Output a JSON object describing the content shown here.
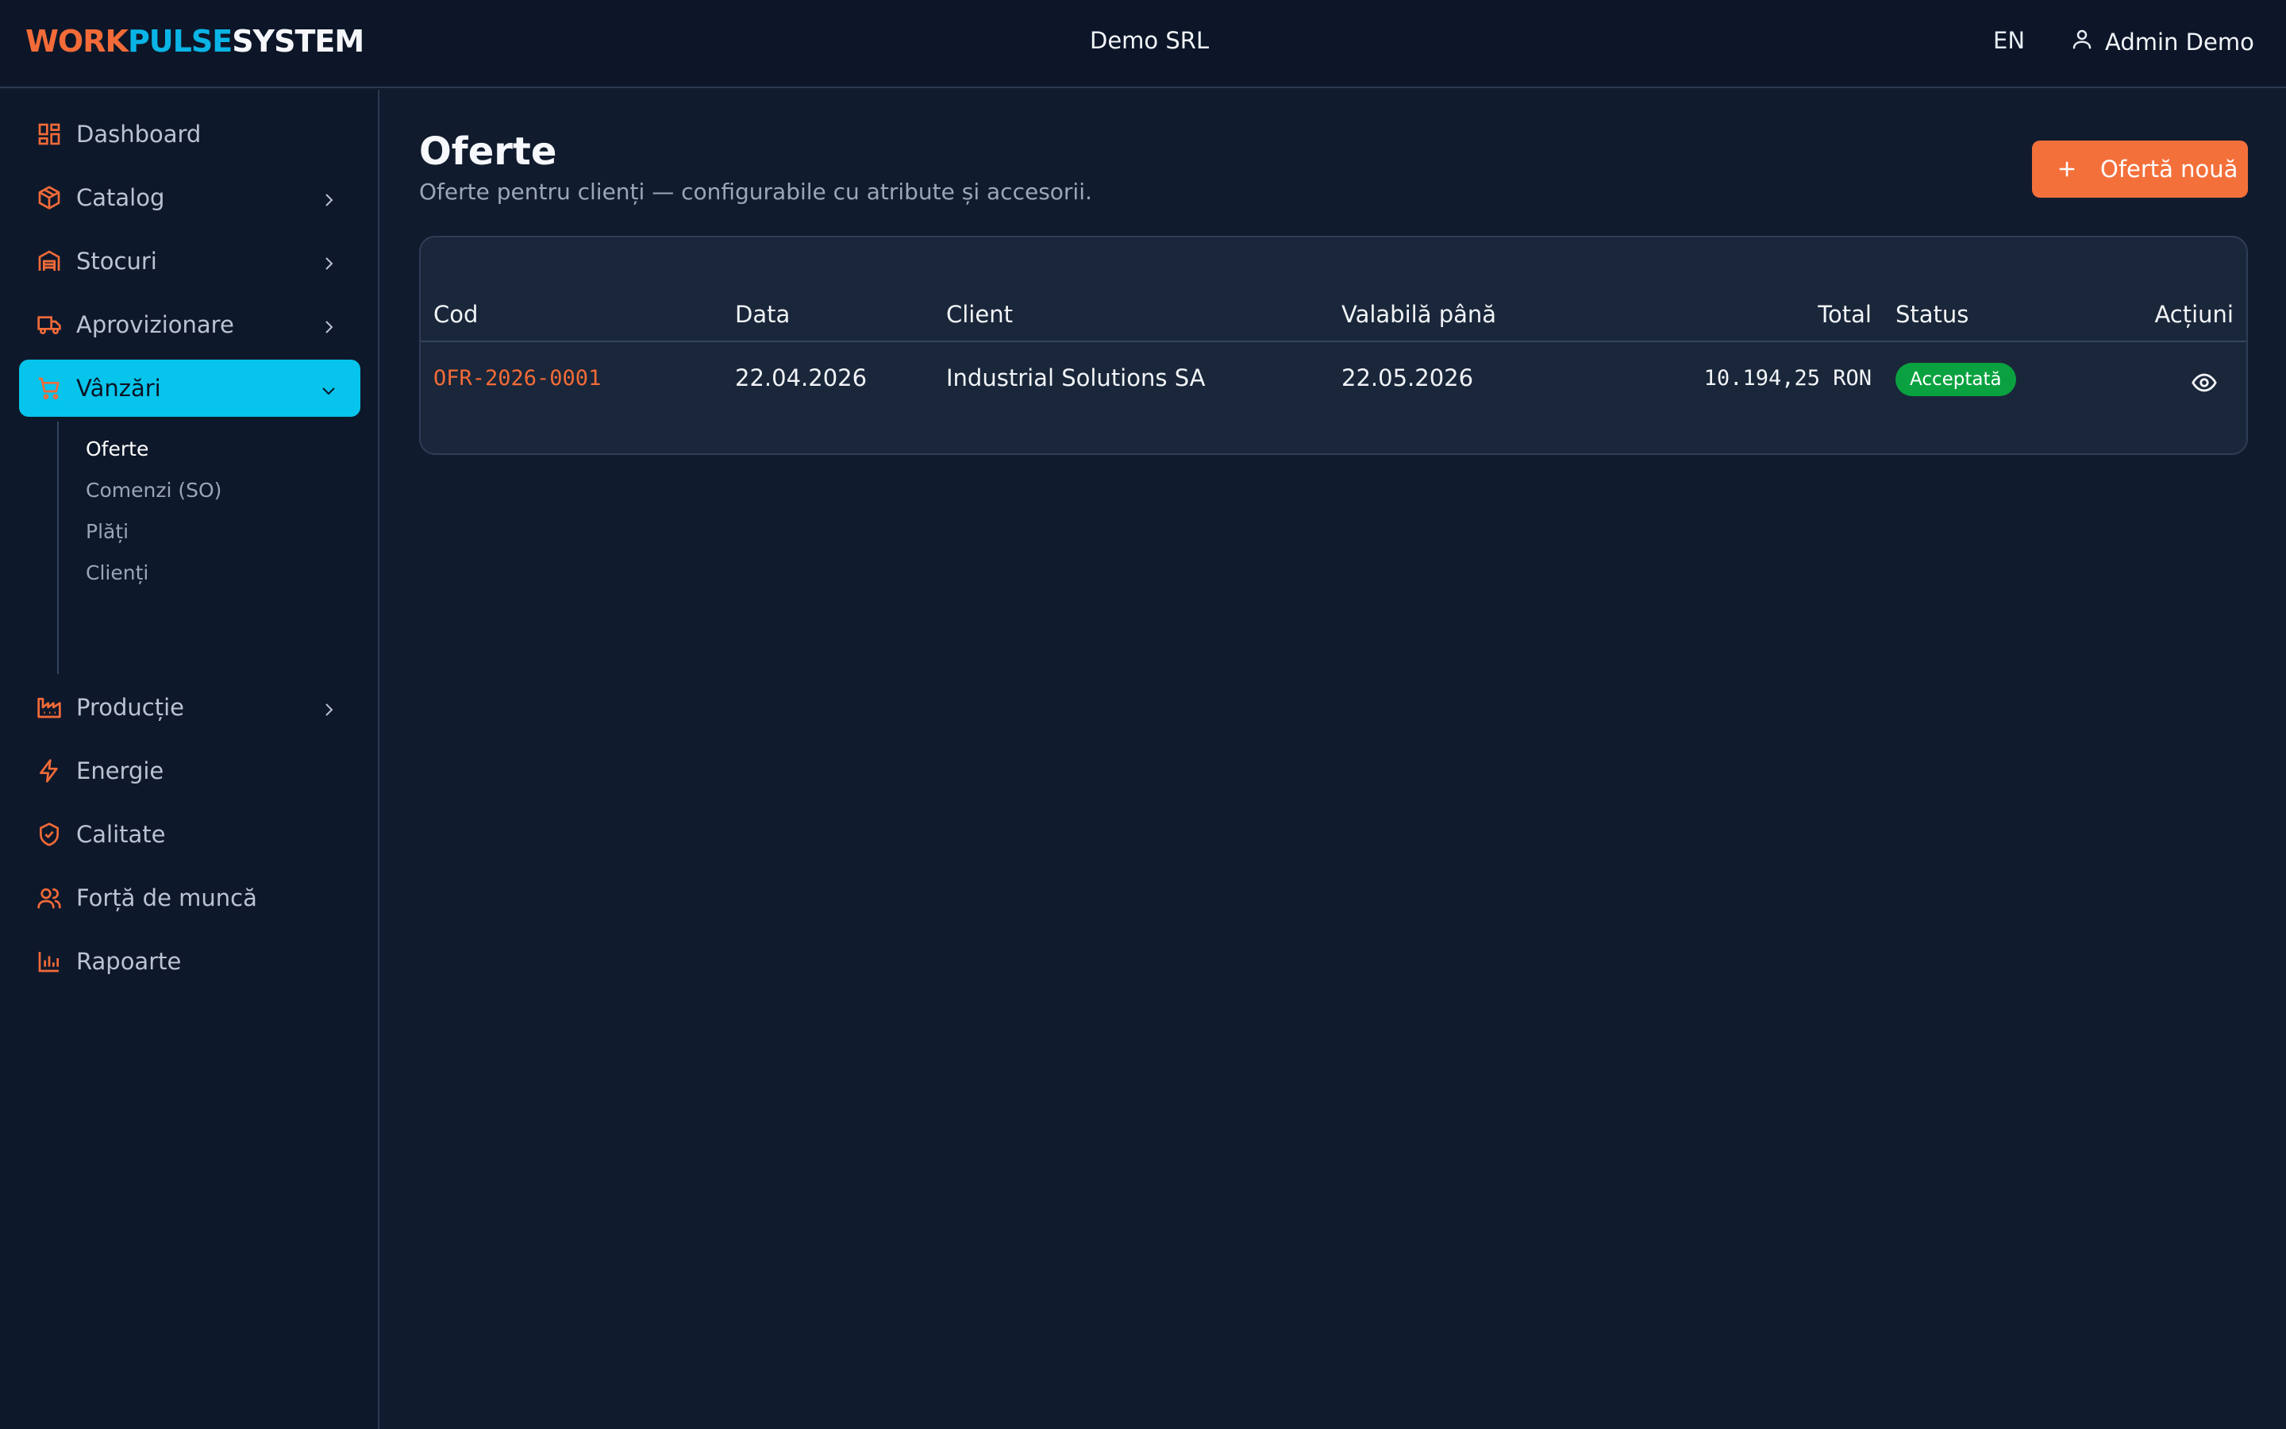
{
  "topbar": {
    "logo_a": "WORK",
    "logo_b": "PULSE",
    "logo_c": "SYSTEM",
    "company": "Demo SRL",
    "language": "EN",
    "user_name": "Admin Demo"
  },
  "sidebar": {
    "items": [
      {
        "label": "Dashboard",
        "icon": "dashboard-icon"
      },
      {
        "label": "Catalog",
        "icon": "box-icon"
      },
      {
        "label": "Stocuri",
        "icon": "warehouse-icon"
      },
      {
        "label": "Aprovizionare",
        "icon": "truck-icon"
      },
      {
        "label": "Vânzări",
        "icon": "cart-icon"
      },
      {
        "label": "Producție",
        "icon": "factory-icon"
      },
      {
        "label": "Energie",
        "icon": "lightning-icon"
      },
      {
        "label": "Calitate",
        "icon": "shield-check-icon"
      },
      {
        "label": "Forță de muncă",
        "icon": "users-icon"
      },
      {
        "label": "Rapoarte",
        "icon": "bar-chart-icon"
      }
    ],
    "sub_items": [
      {
        "label": "Oferte"
      },
      {
        "label": "Comenzi (SO)"
      },
      {
        "label": "Plăți"
      },
      {
        "label": "Clienți"
      }
    ]
  },
  "page": {
    "title": "Oferte",
    "subtitle": "Oferte pentru clienți — configurabile cu atribute și accesorii.",
    "new_button": "Ofertă nouă"
  },
  "table": {
    "headers": {
      "code": "Cod",
      "date": "Data",
      "client": "Client",
      "valid_until": "Valabilă până",
      "total": "Total",
      "status": "Status",
      "actions": "Acțiuni"
    },
    "rows": [
      {
        "code": "OFR-2026-0001",
        "date": "22.04.2026",
        "client": "Industrial Solutions SA",
        "valid_until": "22.05.2026",
        "total": "10.194,25 RON",
        "status": "Acceptată"
      }
    ]
  },
  "colors": {
    "accent": "#f26b38",
    "active_nav": "#06c4ec",
    "status_accepted": "#0aa240"
  }
}
